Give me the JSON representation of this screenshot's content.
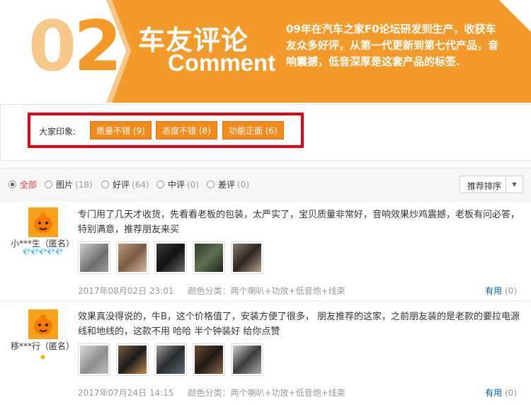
{
  "banner": {
    "number": {
      "first": "0",
      "second": "2"
    },
    "title_cn": "车友评论",
    "title_en": "Comment",
    "description": "09年在汽车之家F0论坛研发到生产，收获车友众多好评，从第一代更新到第七代产品，音响震撼，低音深厚是这套产品的标签.",
    "colors": {
      "orange": "#f39a2a",
      "light_orange": "#f6c98a"
    }
  },
  "impressions": {
    "label": "大家印象:",
    "tags": [
      {
        "text": "质量不错 (9)"
      },
      {
        "text": "态度不错 (8)"
      },
      {
        "text": "功能正面 (6)"
      }
    ],
    "colors": {
      "highlight_border": "#e60012",
      "tag_bg": "#f38a1c"
    }
  },
  "filter": {
    "options": [
      {
        "label": "全部",
        "count": "",
        "selected": true
      },
      {
        "label": "图片",
        "count": "(18)",
        "selected": false
      },
      {
        "label": "好评",
        "count": "(64)",
        "selected": false
      },
      {
        "label": "中评",
        "count": "(0)",
        "selected": false
      },
      {
        "label": "差评",
        "count": "(0)",
        "selected": false
      }
    ],
    "sort_label": "推荐排序",
    "sort_caret": "▼"
  },
  "reviews": [
    {
      "username": "小***生（匿名）",
      "level_icons": "💎💎💎💎💎",
      "content": "专门用了几天才收货，先看看老板的包装，太严实了，宝贝质量非常好，音响效果炒鸡震撼，老板有问必答，特别满意，推荐朋友来买",
      "date": "2017年08月02日 23:01",
      "variant": "颜色分类：两个喇叭+功放+低音炮+线束",
      "useful_label": "有用",
      "useful_count": "(0)",
      "thumb_count": 5
    },
    {
      "username": "移***行（匿名）",
      "level_icons": "◆",
      "content": "效果真没得说的，牛B，这个价格值了，安装方便了很多， 朋友推荐的这家，之前朋友装的是老款的要拉电源线和地线的，这款不用 哈哈 半个钟装好 给你点赞",
      "date": "2017年07月24日 14:15",
      "variant": "颜色分类：两个喇叭+功放+低音炮+线束",
      "useful_label": "有用",
      "useful_count": "(0)",
      "thumb_count": 5
    }
  ]
}
